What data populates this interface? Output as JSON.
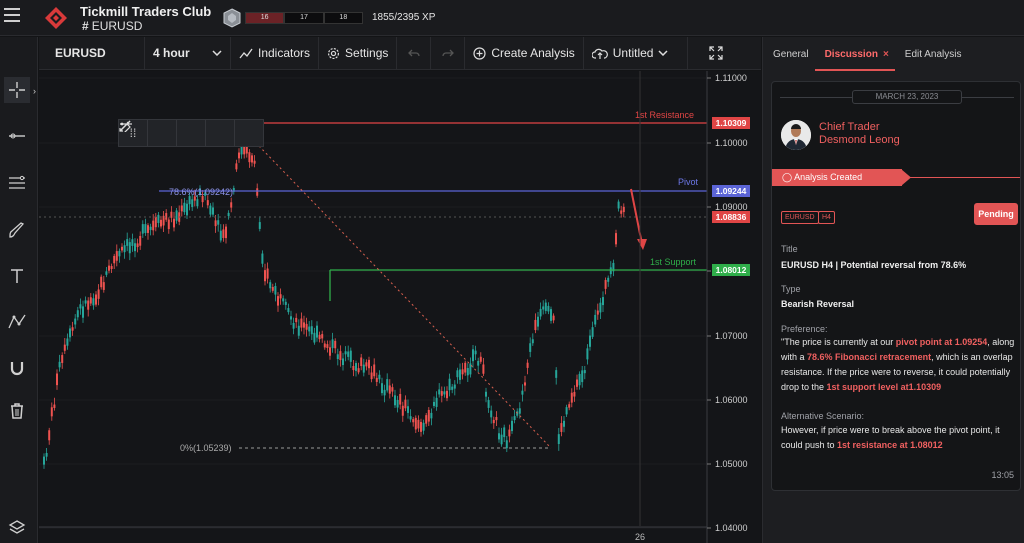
{
  "header": {
    "club_title": "Tickmill Traders Club",
    "channel_hash": "#",
    "channel": "EURUSD",
    "xp_segments": [
      "16",
      "17",
      "18"
    ],
    "xp_text": "1855/2395 XP"
  },
  "toolbar": {
    "symbol": "EURUSD",
    "timeframe": "4 hour",
    "indicators_label": "Indicators",
    "settings_label": "Settings",
    "create_analysis_label": "Create Analysis",
    "layout_name": "Untitled"
  },
  "left_tools": [
    "crosshair-icon",
    "horizontal-line-icon",
    "fib-retracement-icon",
    "brush-icon",
    "text-tool-icon",
    "pattern-icon",
    "magnet-icon",
    "trash-icon",
    "layers-icon"
  ],
  "chart": {
    "price_labels": [
      "1.11000",
      "1.10000",
      "1.09000",
      "1.08000",
      "1.07000",
      "1.06000",
      "1.05000",
      "1.04000"
    ],
    "level_tags": [
      {
        "text": "1.10309",
        "color": "#e04545"
      },
      {
        "text": "1.09244",
        "color": "#5b64d6"
      },
      {
        "text": "1.08836",
        "color": "#e04545"
      },
      {
        "text": "1.08012",
        "color": "#2fae4a"
      }
    ],
    "resistance_label": "1st Resistance",
    "pivot_label": "Pivot",
    "support_label": "1st Support",
    "fib_top_label": "78.6%(1.09242)",
    "fib_bottom_label": "0%(1.05239)",
    "time_label": "26",
    "colors": {
      "bull": "#26a69a",
      "bear": "#ef5350",
      "resistance": "#e04545",
      "pivot": "#5b64d6",
      "support": "#2fae4a"
    }
  },
  "panel": {
    "tabs": [
      "General",
      "Discussion",
      "Edit Analysis"
    ],
    "active_tab": "Discussion",
    "date": "MARCH 23, 2023",
    "author_role": "Chief Trader",
    "author_name": "Desmond Leong",
    "status_banner": "Analysis Created",
    "chips": [
      "EURUSD",
      "H4"
    ],
    "pending_label": "Pending",
    "title_label": "Title",
    "title_value": "EURUSD H4 | Potential reversal from 78.6%",
    "type_label": "Type",
    "type_value": "Bearish Reversal",
    "preference_label": "Preference:",
    "pref_1": " \"The price is currently at our ",
    "pref_hl1": "pivot point at 1.09254",
    "pref_2": ", along with a ",
    "pref_hl2": "78.6% Fibonacci retracement",
    "pref_3": ", which is an overlap resistance. If the price were to reverse, it could potentially drop to the ",
    "pref_hl3": "1st support level at1.10309",
    "alt_label": "Alternative Scenario:",
    "alt_1": " However, if price were to break above the pivot point, it could push to ",
    "alt_hl1": "1st resistance at 1.08012",
    "time": "13:05"
  }
}
